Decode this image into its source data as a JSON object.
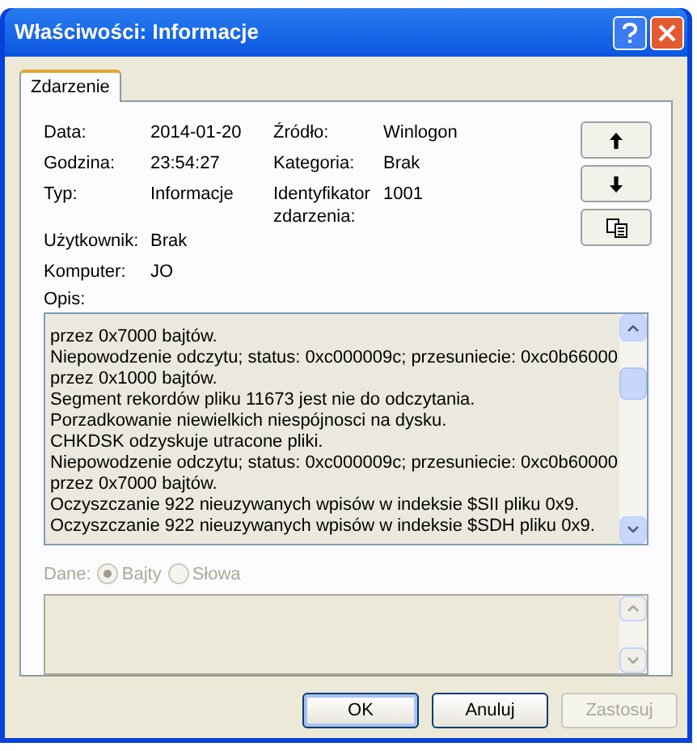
{
  "window": {
    "title": "Właściwości: Informacje"
  },
  "tabs": [
    {
      "label": "Zdarzenie",
      "selected": true
    }
  ],
  "fields_left": [
    {
      "label": "Data:",
      "value": "2014-01-20"
    },
    {
      "label": "Godzina:",
      "value": "23:54:27"
    },
    {
      "label": "Typ:",
      "value": "Informacje"
    }
  ],
  "fields_right": [
    {
      "label": "Źródło:",
      "value": "Winlogon"
    },
    {
      "label": "Kategoria:",
      "value": "Brak"
    },
    {
      "label": "Identyfikator zdarzenia:",
      "value": "1001"
    }
  ],
  "fields_bottom": [
    {
      "label": "Użytkownik:",
      "value": "Brak"
    },
    {
      "label": "Komputer:",
      "value": "JO"
    }
  ],
  "description": {
    "label": "Opis:",
    "lines": [
      "przez 0x7000 bajtów.",
      "Niepowodzenie odczytu; status: 0xc000009c; przesuniecie: 0xc0b66000",
      "przez 0x1000 bajtów.",
      "Segment rekordów pliku 11673 jest nie do odczytania.",
      "Porzadkowanie niewielkich niespójnosci na dysku.",
      "CHKDSK odzyskuje utracone pliki.",
      "Niepowodzenie odczytu; status: 0xc000009c; przesuniecie: 0xc0b60000",
      "przez 0x7000 bajtów.",
      "Oczyszczanie 922 nieuzywanych wpisów w indeksie $SII pliku 0x9.",
      "Oczyszczanie 922 nieuzywanych wpisów w indeksie $SDH pliku 0x9."
    ]
  },
  "data": {
    "label": "Dane:",
    "disabled": true,
    "options": [
      {
        "label": "Bajty",
        "selected": true
      },
      {
        "label": "Słowa",
        "selected": false
      }
    ]
  },
  "buttons": [
    {
      "label": "OK",
      "disabled": false,
      "default": true
    },
    {
      "label": "Anuluj",
      "disabled": false,
      "default": false
    },
    {
      "label": "Zastosuj",
      "disabled": true,
      "default": false
    }
  ]
}
